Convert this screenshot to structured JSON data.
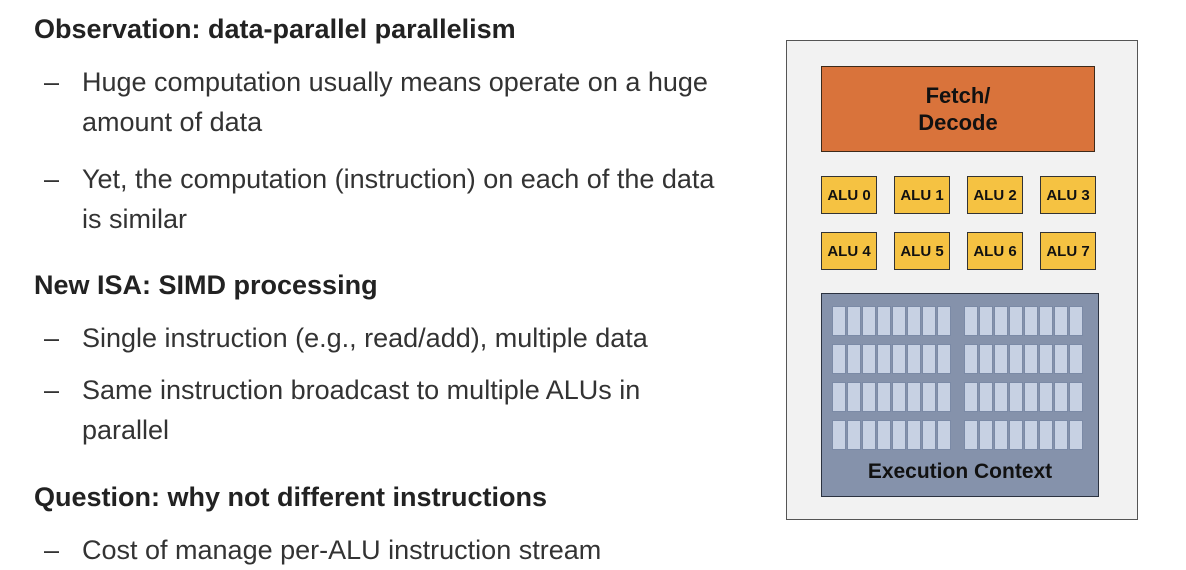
{
  "sections": [
    {
      "heading": "Observation: data-parallel parallelism",
      "bullets": [
        "Huge computation usually means operate on a huge amount of data",
        "Yet, the computation (instruction) on each of the data is similar"
      ]
    },
    {
      "heading": "New ISA: SIMD processing",
      "bullets": [
        "Single instruction (e.g., read/add), multiple data",
        "Same instruction broadcast to multiple ALUs in parallel"
      ]
    },
    {
      "heading": "Question: why not different instructions",
      "bullets": [
        "Cost of manage per-ALU instruction stream"
      ]
    }
  ],
  "bullet_marker": "–",
  "diagram": {
    "fetch_decode": [
      "Fetch/",
      "Decode"
    ],
    "alus": [
      "ALU 0",
      "ALU 1",
      "ALU 2",
      "ALU 3",
      "ALU 4",
      "ALU 5",
      "ALU 6",
      "ALU 7"
    ],
    "execution_context": "Execution Context",
    "colors": {
      "fetch_decode": "#d9733b",
      "alu": "#f5c242",
      "execution_context": "#8592ab",
      "register_cell": "#c7d1e3"
    }
  }
}
